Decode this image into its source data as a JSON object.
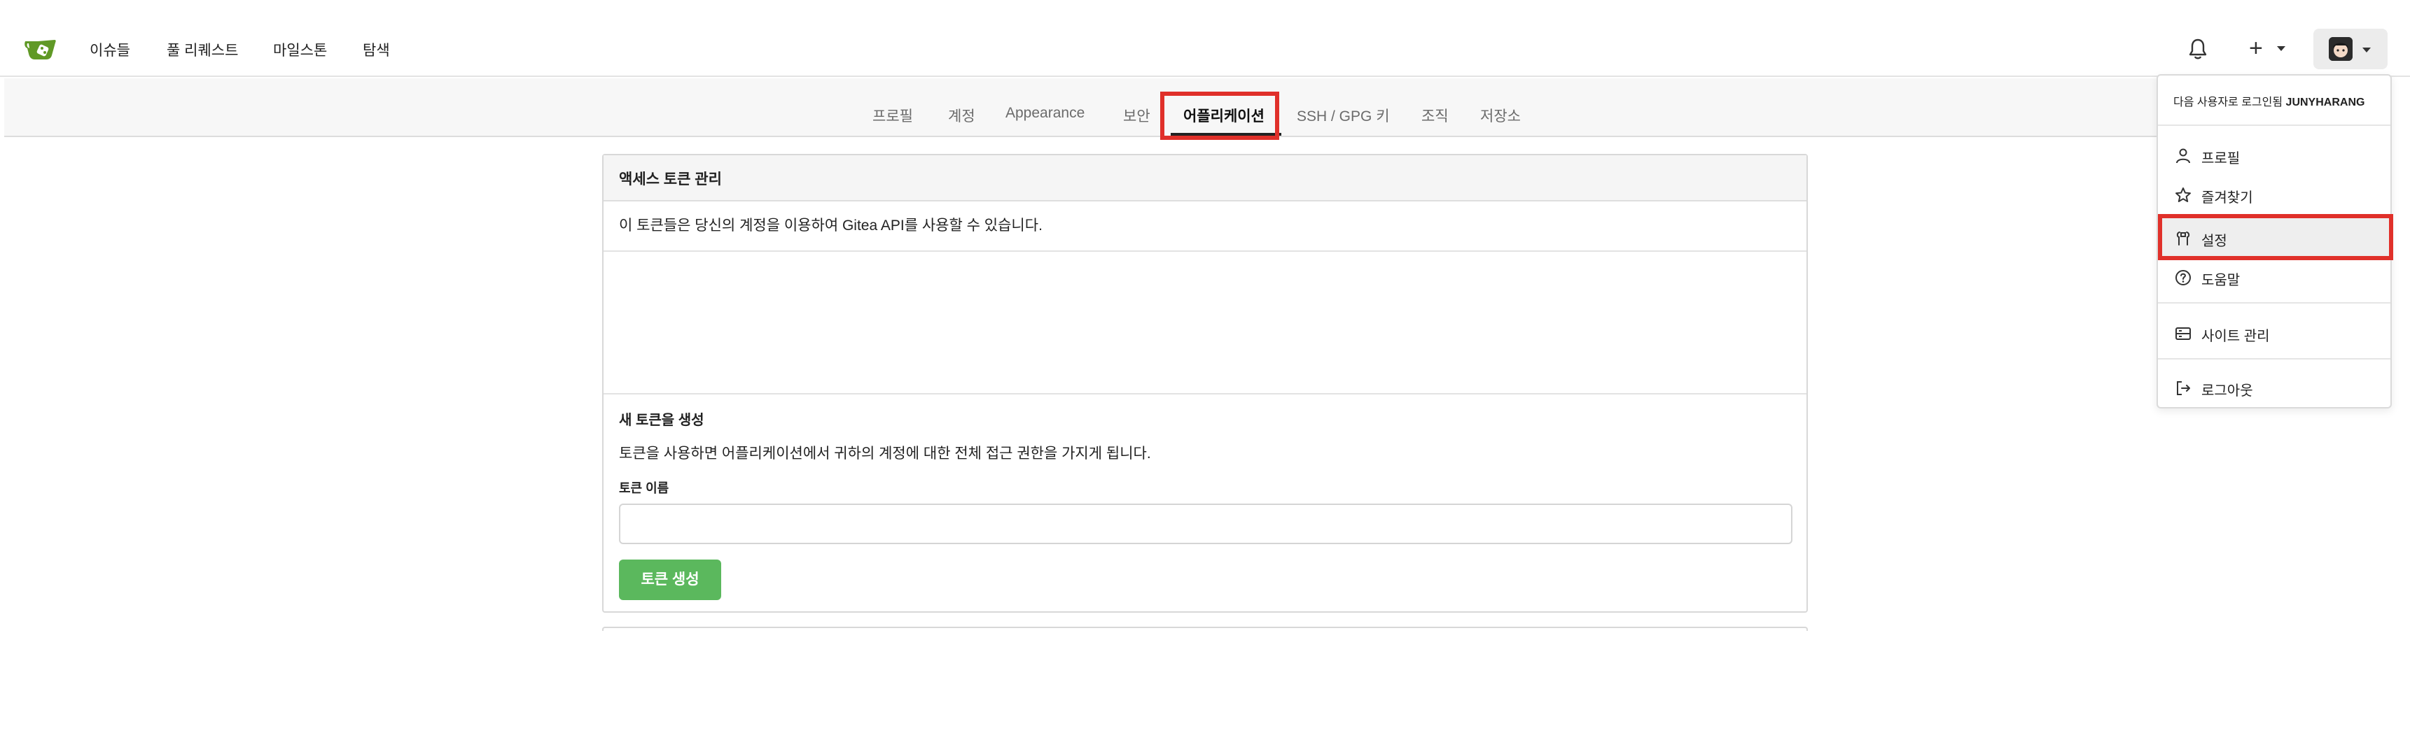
{
  "topbar": {
    "logo_name": "gitea-logo",
    "nav": [
      "이슈들",
      "풀 리퀘스트",
      "마일스톤",
      "탐색"
    ]
  },
  "settings_tabs": [
    "프로필",
    "계정",
    "Appearance",
    "보안",
    "어플리케이션",
    "SSH / GPG 키",
    "조직",
    "저장소"
  ],
  "active_tab": "어플리케이션",
  "tokens_card": {
    "title": "액세스 토큰 관리",
    "description": "이 토큰들은 당신의 계정을 이용하여 Gitea API를 사용할 수 있습니다.",
    "new_token": {
      "title": "새 토큰을 생성",
      "description": "토큰을 사용하면 어플리케이션에서 귀하의 계정에 대한 전체 접근 권한을 가지게 됩니다.",
      "name_label": "토큰 이름",
      "name_value": "",
      "button_label": "토큰 생성"
    }
  },
  "user_menu": {
    "header_prefix": "다음 사용자로 로그인됨",
    "username": "JUNYHARANG",
    "items": [
      {
        "label": "프로필",
        "icon": "person-icon"
      },
      {
        "label": "즐겨찾기",
        "icon": "star-icon"
      },
      {
        "label": "설정",
        "icon": "tools-icon"
      },
      {
        "label": "도움말",
        "icon": "question-icon"
      },
      {
        "label": "사이트 관리",
        "icon": "server-icon"
      },
      {
        "label": "로그아웃",
        "icon": "sign-out-icon"
      }
    ]
  },
  "colors": {
    "accent_green": "#5bb85d",
    "highlight_red": "#e0302a",
    "logo_green": "#609926"
  }
}
